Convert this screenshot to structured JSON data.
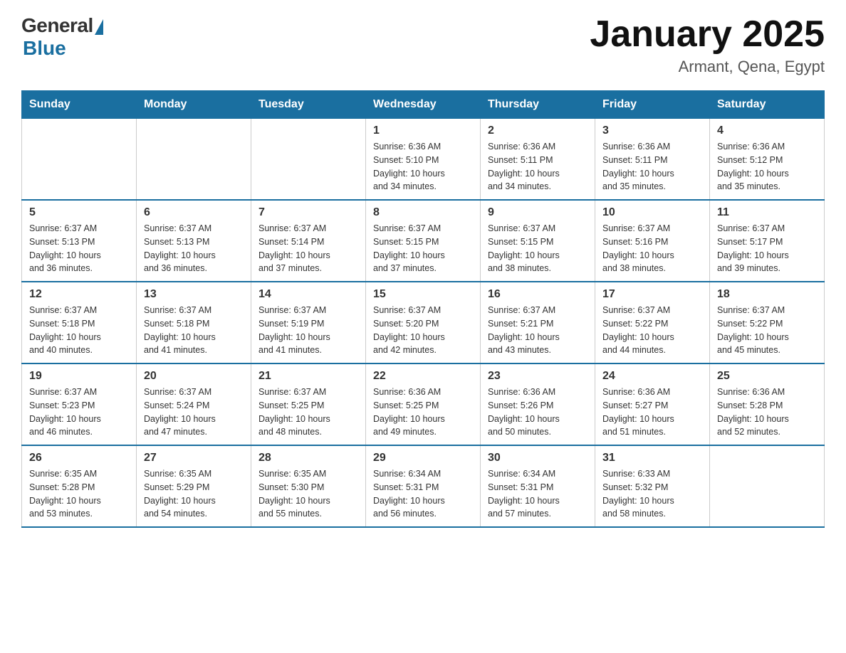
{
  "logo": {
    "general": "General",
    "blue": "Blue"
  },
  "title": "January 2025",
  "location": "Armant, Qena, Egypt",
  "headers": [
    "Sunday",
    "Monday",
    "Tuesday",
    "Wednesday",
    "Thursday",
    "Friday",
    "Saturday"
  ],
  "weeks": [
    [
      {
        "day": "",
        "info": ""
      },
      {
        "day": "",
        "info": ""
      },
      {
        "day": "",
        "info": ""
      },
      {
        "day": "1",
        "info": "Sunrise: 6:36 AM\nSunset: 5:10 PM\nDaylight: 10 hours\nand 34 minutes."
      },
      {
        "day": "2",
        "info": "Sunrise: 6:36 AM\nSunset: 5:11 PM\nDaylight: 10 hours\nand 34 minutes."
      },
      {
        "day": "3",
        "info": "Sunrise: 6:36 AM\nSunset: 5:11 PM\nDaylight: 10 hours\nand 35 minutes."
      },
      {
        "day": "4",
        "info": "Sunrise: 6:36 AM\nSunset: 5:12 PM\nDaylight: 10 hours\nand 35 minutes."
      }
    ],
    [
      {
        "day": "5",
        "info": "Sunrise: 6:37 AM\nSunset: 5:13 PM\nDaylight: 10 hours\nand 36 minutes."
      },
      {
        "day": "6",
        "info": "Sunrise: 6:37 AM\nSunset: 5:13 PM\nDaylight: 10 hours\nand 36 minutes."
      },
      {
        "day": "7",
        "info": "Sunrise: 6:37 AM\nSunset: 5:14 PM\nDaylight: 10 hours\nand 37 minutes."
      },
      {
        "day": "8",
        "info": "Sunrise: 6:37 AM\nSunset: 5:15 PM\nDaylight: 10 hours\nand 37 minutes."
      },
      {
        "day": "9",
        "info": "Sunrise: 6:37 AM\nSunset: 5:15 PM\nDaylight: 10 hours\nand 38 minutes."
      },
      {
        "day": "10",
        "info": "Sunrise: 6:37 AM\nSunset: 5:16 PM\nDaylight: 10 hours\nand 38 minutes."
      },
      {
        "day": "11",
        "info": "Sunrise: 6:37 AM\nSunset: 5:17 PM\nDaylight: 10 hours\nand 39 minutes."
      }
    ],
    [
      {
        "day": "12",
        "info": "Sunrise: 6:37 AM\nSunset: 5:18 PM\nDaylight: 10 hours\nand 40 minutes."
      },
      {
        "day": "13",
        "info": "Sunrise: 6:37 AM\nSunset: 5:18 PM\nDaylight: 10 hours\nand 41 minutes."
      },
      {
        "day": "14",
        "info": "Sunrise: 6:37 AM\nSunset: 5:19 PM\nDaylight: 10 hours\nand 41 minutes."
      },
      {
        "day": "15",
        "info": "Sunrise: 6:37 AM\nSunset: 5:20 PM\nDaylight: 10 hours\nand 42 minutes."
      },
      {
        "day": "16",
        "info": "Sunrise: 6:37 AM\nSunset: 5:21 PM\nDaylight: 10 hours\nand 43 minutes."
      },
      {
        "day": "17",
        "info": "Sunrise: 6:37 AM\nSunset: 5:22 PM\nDaylight: 10 hours\nand 44 minutes."
      },
      {
        "day": "18",
        "info": "Sunrise: 6:37 AM\nSunset: 5:22 PM\nDaylight: 10 hours\nand 45 minutes."
      }
    ],
    [
      {
        "day": "19",
        "info": "Sunrise: 6:37 AM\nSunset: 5:23 PM\nDaylight: 10 hours\nand 46 minutes."
      },
      {
        "day": "20",
        "info": "Sunrise: 6:37 AM\nSunset: 5:24 PM\nDaylight: 10 hours\nand 47 minutes."
      },
      {
        "day": "21",
        "info": "Sunrise: 6:37 AM\nSunset: 5:25 PM\nDaylight: 10 hours\nand 48 minutes."
      },
      {
        "day": "22",
        "info": "Sunrise: 6:36 AM\nSunset: 5:25 PM\nDaylight: 10 hours\nand 49 minutes."
      },
      {
        "day": "23",
        "info": "Sunrise: 6:36 AM\nSunset: 5:26 PM\nDaylight: 10 hours\nand 50 minutes."
      },
      {
        "day": "24",
        "info": "Sunrise: 6:36 AM\nSunset: 5:27 PM\nDaylight: 10 hours\nand 51 minutes."
      },
      {
        "day": "25",
        "info": "Sunrise: 6:36 AM\nSunset: 5:28 PM\nDaylight: 10 hours\nand 52 minutes."
      }
    ],
    [
      {
        "day": "26",
        "info": "Sunrise: 6:35 AM\nSunset: 5:28 PM\nDaylight: 10 hours\nand 53 minutes."
      },
      {
        "day": "27",
        "info": "Sunrise: 6:35 AM\nSunset: 5:29 PM\nDaylight: 10 hours\nand 54 minutes."
      },
      {
        "day": "28",
        "info": "Sunrise: 6:35 AM\nSunset: 5:30 PM\nDaylight: 10 hours\nand 55 minutes."
      },
      {
        "day": "29",
        "info": "Sunrise: 6:34 AM\nSunset: 5:31 PM\nDaylight: 10 hours\nand 56 minutes."
      },
      {
        "day": "30",
        "info": "Sunrise: 6:34 AM\nSunset: 5:31 PM\nDaylight: 10 hours\nand 57 minutes."
      },
      {
        "day": "31",
        "info": "Sunrise: 6:33 AM\nSunset: 5:32 PM\nDaylight: 10 hours\nand 58 minutes."
      },
      {
        "day": "",
        "info": ""
      }
    ]
  ]
}
